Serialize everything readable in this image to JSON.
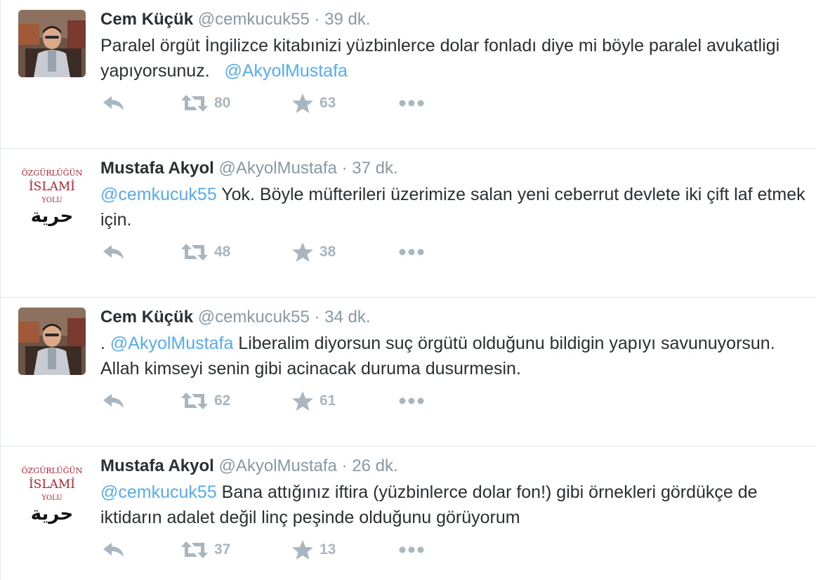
{
  "tweets": [
    {
      "avatar": "photo",
      "fullname": "Cem Küçük",
      "username": "@cemkucuk55",
      "separator": "·",
      "time": "39 dk.",
      "text_before": "Paralel örgüt İngilizce kitabınizi yüzbinlerce dolar fonladı diye mi böyle paralel avukatligi yapıyorsunuz.",
      "mention": "@AkyolMustafa",
      "text_after": "",
      "retweets": "80",
      "favorites": "63"
    },
    {
      "avatar": "book",
      "fullname": "Mustafa Akyol",
      "username": "@AkyolMustafa",
      "separator": "·",
      "time": "37 dk.",
      "text_before": "",
      "mention": "@cemkucuk55",
      "text_after": " Yok. Böyle müfterileri üzerimize salan yeni ceberrut devlete iki çift laf etmek için.",
      "retweets": "48",
      "favorites": "38"
    },
    {
      "avatar": "photo",
      "fullname": "Cem Küçük",
      "username": "@cemkucuk55",
      "separator": "·",
      "time": "34 dk.",
      "text_before": ". ",
      "mention": "@AkyolMustafa",
      "text_after": " Liberalim diyorsun suç örgütü olduğunu bildigin yapıyı savunuyorsun. Allah kimseyi senin gibi acinacak duruma dusurmesin.",
      "retweets": "62",
      "favorites": "61"
    },
    {
      "avatar": "book",
      "fullname": "Mustafa Akyol",
      "username": "@AkyolMustafa",
      "separator": "·",
      "time": "26 dk.",
      "text_before": "",
      "mention": "@cemkucuk55",
      "text_after": " Bana attığınız iftira (yüzbinlerce dolar fon!) gibi örnekleri gördükçe de iktidarın adalet değil linç peşinde olduğunu görüyorum",
      "retweets": "37",
      "favorites": "13"
    }
  ],
  "book_cover": {
    "line1": "ÖZGÜRLÜĞÜN",
    "line2": "İSLAMİ",
    "line3": "YOLU",
    "arabic": "حرية"
  },
  "icons": {
    "reply": "reply-arrow-icon",
    "retweet": "retweet-icon",
    "favorite": "star-icon",
    "more": "more-dots-icon"
  },
  "colors": {
    "text": "#292f33",
    "muted": "#8899a6",
    "mention": "#55acee",
    "action": "#a9b6c0",
    "border": "#e1e8ed",
    "book_red": "#b8202e"
  }
}
